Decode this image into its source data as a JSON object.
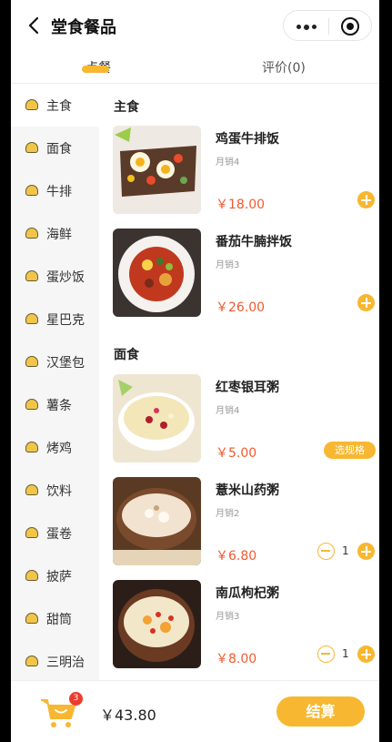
{
  "header": {
    "title": "堂食餐品"
  },
  "tabs": [
    {
      "label": "点餐"
    },
    {
      "label": "评价(0)"
    }
  ],
  "nav": {
    "items": [
      {
        "label": "主食"
      },
      {
        "label": "面食"
      },
      {
        "label": "牛排"
      },
      {
        "label": "海鲜"
      },
      {
        "label": "蛋炒饭"
      },
      {
        "label": "星巴克"
      },
      {
        "label": "汉堡包"
      },
      {
        "label": "薯条"
      },
      {
        "label": "烤鸡"
      },
      {
        "label": "饮料"
      },
      {
        "label": "蛋卷"
      },
      {
        "label": "披萨"
      },
      {
        "label": "甜筒"
      },
      {
        "label": "三明治"
      }
    ],
    "active": "主食"
  },
  "sections": [
    {
      "title": "主食",
      "items": [
        {
          "name": "鸡蛋牛排饭",
          "sales": "月销4",
          "price": "￥18.00",
          "action": "add"
        },
        {
          "name": "番茄牛腩拌饭",
          "sales": "月销3",
          "price": "￥26.00",
          "action": "add"
        }
      ]
    },
    {
      "title": "面食",
      "items": [
        {
          "name": "红枣银耳粥",
          "sales": "月销4",
          "price": "￥5.00",
          "action": "spec",
          "spec_label": "选规格"
        },
        {
          "name": "薏米山药粥",
          "sales": "月销2",
          "price": "￥6.80",
          "action": "stepper",
          "qty": "1"
        },
        {
          "name": "南瓜枸杞粥",
          "sales": "月销3",
          "price": "￥8.00",
          "action": "stepper",
          "qty": "1"
        }
      ]
    }
  ],
  "cart": {
    "badge": "3",
    "total": "￥43.80",
    "checkout_label": "结算"
  },
  "colors": {
    "accent": "#f7b731",
    "price": "#f05a2e",
    "badge": "#ee3b2f"
  }
}
